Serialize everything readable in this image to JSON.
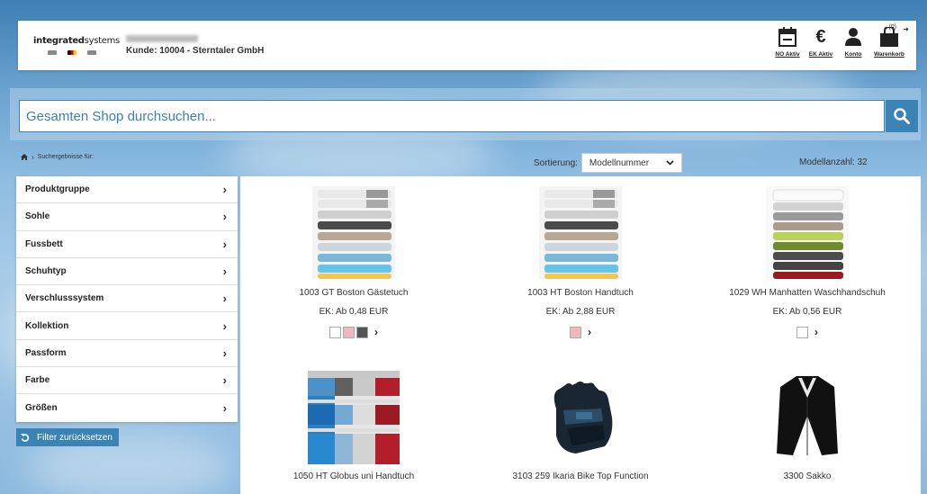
{
  "header": {
    "logo_bold": "integrated",
    "logo_light": "systems",
    "customer": "Kunde: 10004 - Sterntaler GmbH",
    "icons": [
      {
        "name": "calendar-icon",
        "label": "NO Aktiv"
      },
      {
        "name": "euro-icon",
        "label": "EK Aktiv"
      },
      {
        "name": "user-icon",
        "label": "Konto"
      },
      {
        "name": "cart-icon",
        "label": "Warenkorb"
      }
    ],
    "cart_count": "(0)"
  },
  "search": {
    "placeholder": "Gesamten Shop durchsuchen..."
  },
  "breadcrumb": {
    "label": "Suchergebnisse für:"
  },
  "sort": {
    "label": "Sortierung:",
    "selected": "Modellnummer"
  },
  "count": "Modellanzahl: 32",
  "filters": [
    "Produktgruppe",
    "Sohle",
    "Fussbett",
    "Schuhtyp",
    "Verschlusssystem",
    "Kollektion",
    "Passform",
    "Farbe",
    "Größen"
  ],
  "reset_label": "Filter zurücksetzen",
  "products": [
    {
      "name": "1003 GT Boston Gästetuch",
      "price": "EK: Ab 0,48 EUR",
      "swatches": [
        "#ffffff",
        "#f2b6c0",
        "#555555"
      ],
      "image": "towel-stack"
    },
    {
      "name": "1003 HT Boston Handtuch",
      "price": "EK: Ab 2,88 EUR",
      "swatches": [
        "#f2b6c0"
      ],
      "image": "towel-stack"
    },
    {
      "name": "1029 WH Manhatten Waschhandschuh",
      "price": "EK: Ab 0,56 EUR",
      "swatches": [
        "#ffffff"
      ],
      "image": "towel-stack-green"
    },
    {
      "name": "1050 HT Globus uni Handtuch",
      "price": "",
      "swatches": [],
      "image": "towel-shelf"
    },
    {
      "name": "3103 259 Ikaria Bike Top Function",
      "price": "",
      "swatches": [],
      "image": "bike-glove"
    },
    {
      "name": "3300 Sakko",
      "price": "",
      "swatches": [],
      "image": "jacket"
    }
  ]
}
